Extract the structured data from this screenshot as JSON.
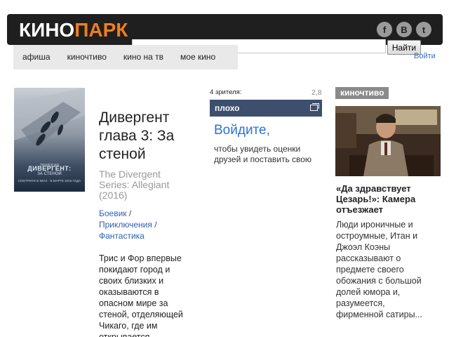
{
  "header": {
    "logo_part1": "КИНО",
    "logo_part2": "ПАРК",
    "social": [
      {
        "icon": "facebook-icon",
        "glyph": "f"
      },
      {
        "icon": "vkontakte-icon",
        "glyph": "B"
      },
      {
        "icon": "twitter-icon",
        "glyph": "t"
      }
    ],
    "search_value": "",
    "search_button": "Найти",
    "login_link": "Войти"
  },
  "nav": {
    "items": [
      "афиша",
      "киночтиво",
      "кино на тв",
      "мое кино"
    ]
  },
  "poster": {
    "top_text": "ТРИЛОГИЯ",
    "title": "ДИВЕРГЕНТ:",
    "subtitle": "ЗА СТЕНОЙ",
    "date_text": "СМОТРИТЕ В IMAX · В МАРТЕ 2016 ГОДА"
  },
  "movie": {
    "title": "Дивергент глава 3: За стеной",
    "original_title": "The Divergent Series: Allegiant (2016)",
    "genres": [
      "Боевик",
      "Приключения",
      "Фантастика"
    ],
    "genre_sep": " /",
    "description": "Трис и Фор впервые покидают город и своих близких и оказываются в опасном мире за стеной, отделяющей Чикаго, где им открывается"
  },
  "rating": {
    "viewers": "4 зрителя:",
    "value": "2,8",
    "label": "плохо",
    "login_text": "Войдите,",
    "login_hint": "чтобы увидеть оценки друзей и поставить свою"
  },
  "sidebar": {
    "tag": "киночтиво",
    "title": "«Да здравствует Цезарь!»: Камера отъезжает",
    "text": "Люди ироничные и остроумные, Итан и Джоэл Коэны рассказывают о предмете своего обожания с большой долей юмора и, разумеется, фирменной сатиры..."
  },
  "colors": {
    "header_bg": "#1f1f1f",
    "accent_orange": "#f07e1d",
    "link_blue": "#2f5fb3",
    "rating_bar": "#3d4f6d",
    "tag_gray": "#8a8a8a"
  }
}
